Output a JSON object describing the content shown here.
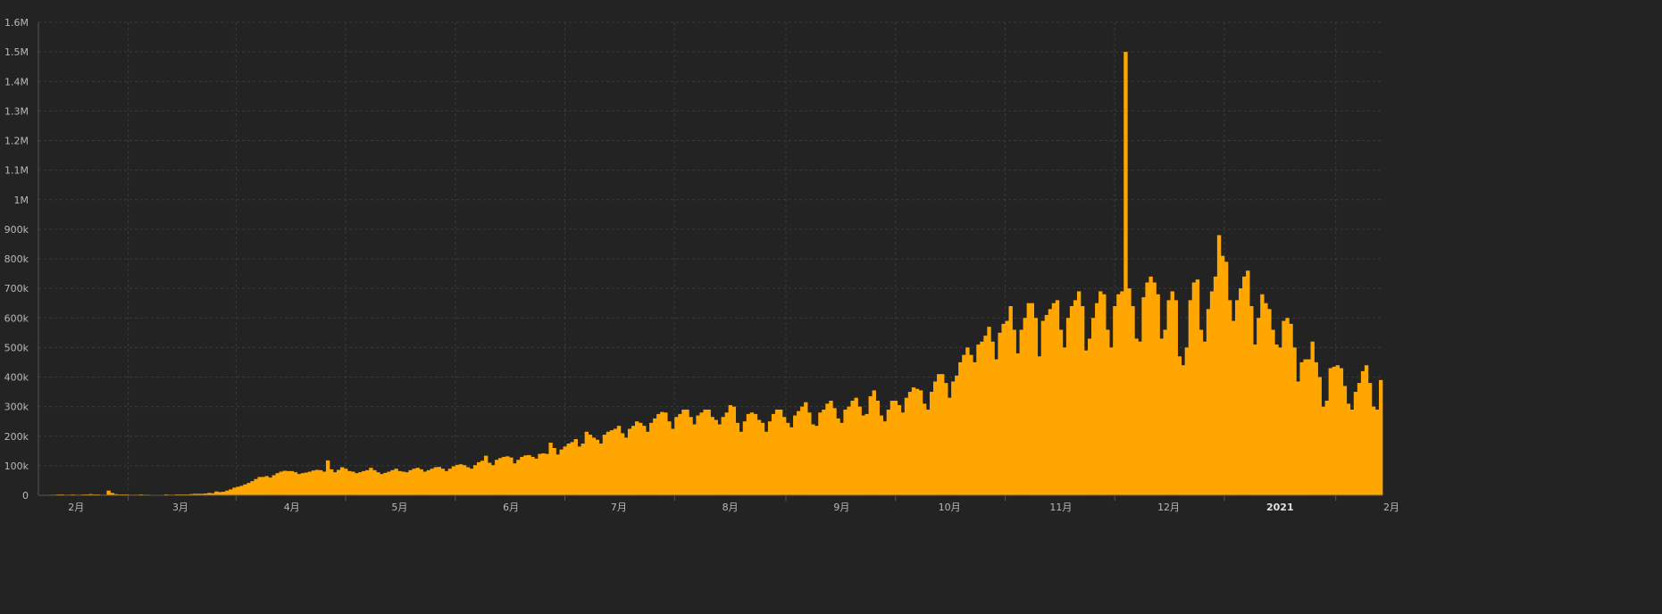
{
  "chart_data": {
    "type": "bar",
    "title": "",
    "xlabel": "",
    "ylabel": "",
    "grid": true,
    "colors": {
      "background": "#232323",
      "bar": "#ffa600",
      "grid": "#3a3a3a",
      "axis": "#555555",
      "text": "#b9b9b9"
    },
    "ylim": [
      0,
      1600000
    ],
    "y_ticks": [
      {
        "value": 0,
        "label": "0"
      },
      {
        "value": 100000,
        "label": "100k"
      },
      {
        "value": 200000,
        "label": "200k"
      },
      {
        "value": 300000,
        "label": "300k"
      },
      {
        "value": 400000,
        "label": "400k"
      },
      {
        "value": 500000,
        "label": "500k"
      },
      {
        "value": 600000,
        "label": "600k"
      },
      {
        "value": 700000,
        "label": "700k"
      },
      {
        "value": 800000,
        "label": "800k"
      },
      {
        "value": 900000,
        "label": "900k"
      },
      {
        "value": 1000000,
        "label": "1M"
      },
      {
        "value": 1100000,
        "label": "1.1M"
      },
      {
        "value": 1200000,
        "label": "1.2M"
      },
      {
        "value": 1300000,
        "label": "1.3M"
      },
      {
        "value": 1400000,
        "label": "1.4M"
      },
      {
        "value": 1500000,
        "label": "1.5M"
      },
      {
        "value": 1600000,
        "label": "1.6M"
      }
    ],
    "x_ticks": [
      {
        "index": 10,
        "label": "2月",
        "bold": false
      },
      {
        "index": 39,
        "label": "3月",
        "bold": false
      },
      {
        "index": 70,
        "label": "4月",
        "bold": false
      },
      {
        "index": 100,
        "label": "5月",
        "bold": false
      },
      {
        "index": 131,
        "label": "6月",
        "bold": false
      },
      {
        "index": 161,
        "label": "7月",
        "bold": false
      },
      {
        "index": 192,
        "label": "8月",
        "bold": false
      },
      {
        "index": 223,
        "label": "9月",
        "bold": false
      },
      {
        "index": 253,
        "label": "10月",
        "bold": false
      },
      {
        "index": 284,
        "label": "11月",
        "bold": false
      },
      {
        "index": 314,
        "label": "12月",
        "bold": false
      },
      {
        "index": 345,
        "label": "2021",
        "bold": true
      },
      {
        "index": 376,
        "label": "2月",
        "bold": false
      }
    ],
    "series": [
      {
        "values": [
          1000,
          1000,
          1000,
          2000,
          2000,
          3000,
          3000,
          2000,
          2000,
          3000,
          2000,
          2000,
          3000,
          3000,
          4000,
          3000,
          3000,
          2000,
          2000,
          16000,
          8000,
          4000,
          3000,
          3000,
          3000,
          2000,
          2000,
          2000,
          3000,
          2000,
          2000,
          1000,
          1000,
          1000,
          1000,
          3000,
          2000,
          2000,
          3000,
          3000,
          3000,
          3000,
          4000,
          5000,
          5000,
          5000,
          6000,
          8000,
          7000,
          13000,
          11000,
          12000,
          16000,
          20000,
          26000,
          29000,
          32000,
          37000,
          42000,
          48000,
          55000,
          62000,
          62000,
          65000,
          60000,
          68000,
          75000,
          80000,
          83000,
          82000,
          82000,
          78000,
          72000,
          75000,
          77000,
          80000,
          84000,
          86000,
          85000,
          80000,
          118000,
          88000,
          78000,
          86000,
          95000,
          90000,
          82000,
          80000,
          75000,
          78000,
          82000,
          85000,
          93000,
          85000,
          78000,
          72000,
          76000,
          80000,
          85000,
          90000,
          82000,
          80000,
          78000,
          85000,
          90000,
          93000,
          88000,
          80000,
          85000,
          90000,
          95000,
          96000,
          90000,
          82000,
          90000,
          98000,
          103000,
          105000,
          102000,
          95000,
          90000,
          102000,
          112000,
          117000,
          134000,
          110000,
          102000,
          120000,
          126000,
          130000,
          132000,
          128000,
          108000,
          120000,
          130000,
          135000,
          136000,
          130000,
          124000,
          140000,
          142000,
          140000,
          178000,
          160000,
          138000,
          155000,
          165000,
          175000,
          180000,
          190000,
          165000,
          175000,
          215000,
          205000,
          195000,
          188000,
          175000,
          205000,
          215000,
          220000,
          225000,
          235000,
          210000,
          195000,
          225000,
          235000,
          250000,
          245000,
          235000,
          215000,
          245000,
          260000,
          275000,
          282000,
          280000,
          250000,
          225000,
          265000,
          275000,
          290000,
          290000,
          265000,
          240000,
          270000,
          280000,
          290000,
          290000,
          265000,
          255000,
          240000,
          265000,
          280000,
          305000,
          300000,
          245000,
          215000,
          250000,
          275000,
          280000,
          275000,
          255000,
          245000,
          215000,
          250000,
          275000,
          290000,
          290000,
          265000,
          245000,
          230000,
          270000,
          285000,
          300000,
          315000,
          280000,
          240000,
          235000,
          280000,
          290000,
          310000,
          320000,
          295000,
          260000,
          245000,
          290000,
          300000,
          320000,
          330000,
          300000,
          270000,
          275000,
          335000,
          355000,
          320000,
          270000,
          250000,
          290000,
          320000,
          320000,
          305000,
          280000,
          330000,
          350000,
          365000,
          360000,
          355000,
          310000,
          290000,
          350000,
          385000,
          410000,
          410000,
          380000,
          330000,
          385000,
          405000,
          450000,
          475000,
          500000,
          475000,
          450000,
          510000,
          520000,
          540000,
          570000,
          520000,
          460000,
          550000,
          580000,
          590000,
          640000,
          560000,
          480000,
          560000,
          600000,
          650000,
          650000,
          600000,
          470000,
          590000,
          610000,
          630000,
          650000,
          660000,
          560000,
          500000,
          600000,
          640000,
          660000,
          690000,
          640000,
          490000,
          530000,
          600000,
          650000,
          690000,
          680000,
          560000,
          500000,
          640000,
          680000,
          690000,
          1500000,
          700000,
          640000,
          530000,
          520000,
          670000,
          720000,
          740000,
          720000,
          680000,
          530000,
          560000,
          660000,
          690000,
          660000,
          470000,
          440000,
          500000,
          660000,
          720000,
          730000,
          560000,
          520000,
          630000,
          690000,
          740000,
          880000,
          810000,
          790000,
          660000,
          590000,
          660000,
          700000,
          740000,
          760000,
          640000,
          510000,
          600000,
          680000,
          650000,
          630000,
          560000,
          510000,
          500000,
          590000,
          600000,
          580000,
          500000,
          385000,
          450000,
          460000,
          460000,
          520000,
          450000,
          400000,
          300000,
          320000,
          430000,
          435000,
          440000,
          430000,
          370000,
          310000,
          290000,
          350000,
          380000,
          420000,
          440000,
          380000,
          300000,
          290000,
          390000
        ]
      }
    ]
  }
}
